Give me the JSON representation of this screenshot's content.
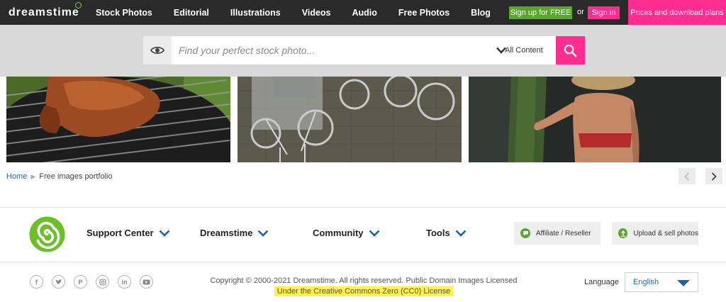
{
  "header": {
    "logo": "dreamstime",
    "nav": [
      "Stock Photos",
      "Editorial",
      "Illustrations",
      "Videos",
      "Audio",
      "Free Photos",
      "Blog"
    ],
    "signup_label": "Sign up for FREE",
    "or_label": "or",
    "signin_label": "Sign in",
    "prices_label": "Prices and download plans"
  },
  "search": {
    "placeholder": "Find your perfect stock photo...",
    "content_filter": "All Content"
  },
  "breadcrumb": {
    "home": "Home",
    "current": "Free images portfolio"
  },
  "footer": {
    "menu": [
      "Support Center",
      "Dreamstime",
      "Community",
      "Tools"
    ],
    "affiliate_label": "Affiliate / Reseller",
    "upload_label": "Upload & sell photos",
    "copyright": "Copyright © 2000-2021 Dreamstime. All rights reserved. Public Domain Images Licensed",
    "license": "Under the Creative Commons Zero (CC0) License",
    "language_label": "Language",
    "language_value": "English",
    "social_icons": [
      "facebook-icon",
      "twitter-icon",
      "pinterest-icon",
      "instagram-icon",
      "linkedin-icon",
      "youtube-icon"
    ]
  },
  "colors": {
    "nav_bg": "#2a2a2a",
    "accent_pink": "#ff2d8f",
    "accent_green": "#58a72c",
    "link_blue": "#2468b8",
    "highlight_yellow": "#fff04a"
  }
}
